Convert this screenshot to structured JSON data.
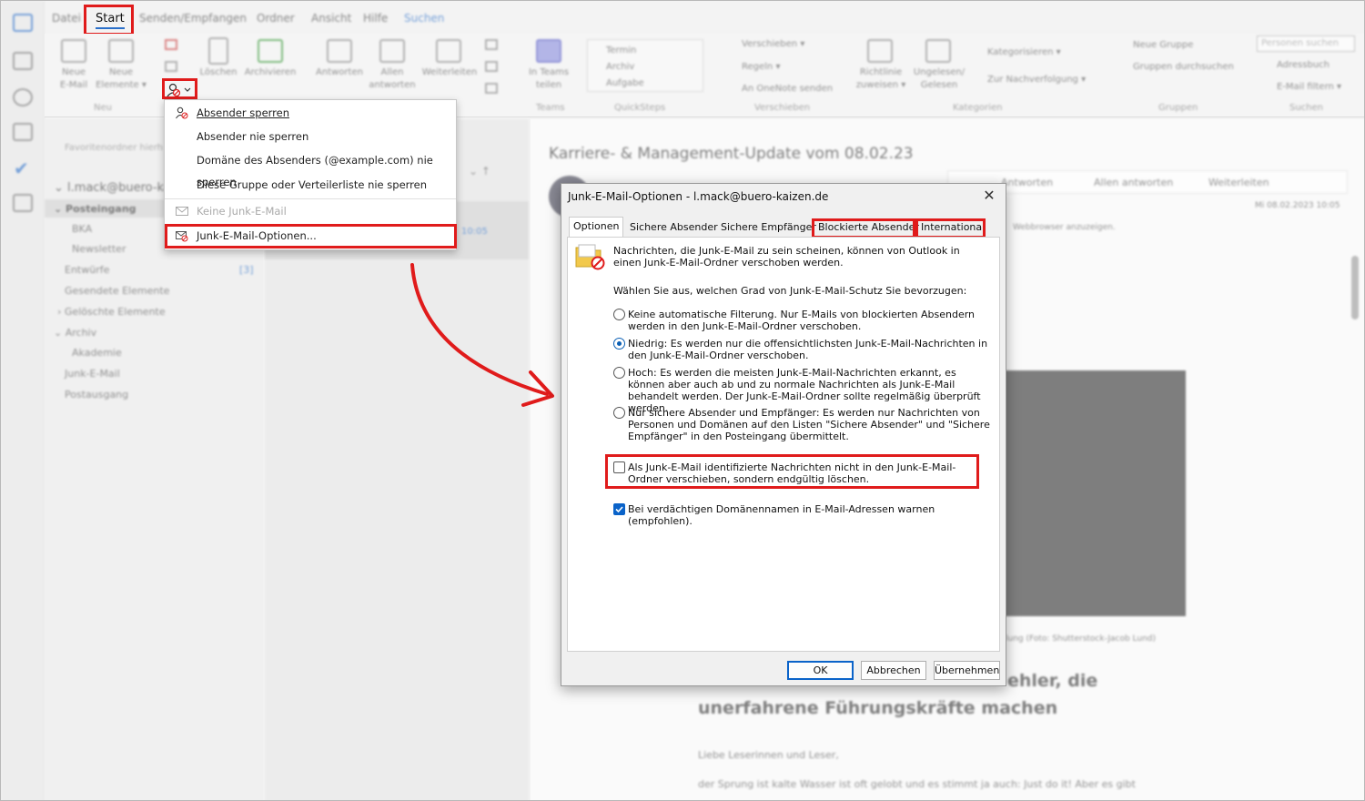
{
  "menubar": {
    "items": [
      "Datei",
      "Start",
      "Senden/Empfangen",
      "Ordner",
      "Ansicht",
      "Hilfe",
      "Suchen"
    ]
  },
  "ribbon": {
    "buttons": [
      {
        "label": "Neue\nE-Mail"
      },
      {
        "label": "Neue\nElemente ▾"
      },
      {
        "label": "Löschen"
      },
      {
        "label": "Archivieren"
      },
      {
        "label": "Antworten"
      },
      {
        "label": "Allen\nantworten"
      },
      {
        "label": "Weiterleiten"
      },
      {
        "label": "In Teams\nteilen"
      },
      {
        "label": "Richtlinie\nzuweisen ▾"
      },
      {
        "label": "Ungelesen/\nGelesen"
      }
    ],
    "quicksteps": [
      "Termin",
      "Archiv",
      "Aufgabe"
    ],
    "move": [
      "Verschieben ▾",
      "Regeln ▾",
      "An OneNote senden"
    ],
    "tags": [
      "Kategorisieren ▾",
      "Zur Nachverfolgung ▾"
    ],
    "groups_items": [
      "Neue Gruppe",
      "Gruppen durchsuchen"
    ],
    "search": {
      "placeholder": "Personen suchen",
      "items": [
        "Adressbuch",
        "E-Mail filtern ▾"
      ]
    },
    "group_labels": [
      "Neu",
      "Teams",
      "QuickSteps",
      "Verschieben",
      "Kategorien",
      "Gruppen",
      "Suchen"
    ]
  },
  "sidebar": {
    "favorites_hint": "Favoritenordner hierh",
    "account": "l.mack@buero-ka",
    "folders": [
      {
        "label": "Posteingang",
        "bold": true
      },
      {
        "label": "BKA"
      },
      {
        "label": "Newsletter"
      },
      {
        "label": "Entwürfe",
        "count": "[3]"
      },
      {
        "label": "Gesendete Elemente"
      },
      {
        "label": "Gelöschte Elemente"
      },
      {
        "label": "Archiv"
      },
      {
        "label": "Akademie"
      },
      {
        "label": "Junk-E-Mail"
      },
      {
        "label": "Postausgang"
      }
    ]
  },
  "reading": {
    "subject": "Karriere- & Management-Update vom 08.02.23",
    "actions": [
      "Antworten",
      "Allen antworten",
      "Weiterleiten"
    ],
    "date": "Mi 08.02.2023 10:05",
    "browser_hint": "Webbrowser anzuzeigen.",
    "caption": "lung (Foto: Shutterstock-Jacob Lund)",
    "headline_1": "ehler, die",
    "headline_2": "unerfahrene Führungskräfte machen",
    "body_1": "Liebe Leserinnen und Leser,",
    "body_2": "der Sprung ist kalte Wasser ist oft gelobt und es stimmt ja auch: Just do it! Aber es gibt"
  },
  "msglist": {
    "time": "10:05"
  },
  "context_menu": {
    "items": [
      {
        "label": "Absender sperren",
        "enabled": true,
        "icon": "block-sender-icon"
      },
      {
        "label": "Absender nie sperren",
        "enabled": true
      },
      {
        "label": "Domäne des Absenders (@example.com) nie sperren",
        "enabled": true
      },
      {
        "label": "Diese Gruppe oder Verteilerliste nie sperren",
        "enabled": true
      },
      {
        "label": "Keine Junk-E-Mail",
        "enabled": false,
        "icon": "mail-icon"
      },
      {
        "label": "Junk-E-Mail-Optionen...",
        "enabled": true,
        "icon": "junk-options-icon"
      }
    ]
  },
  "dialog": {
    "title": "Junk-E-Mail-Optionen - l.mack@buero-kaizen.de",
    "tabs": [
      "Optionen",
      "Sichere Absender",
      "Sichere Empfänger",
      "Blockierte Absender",
      "International"
    ],
    "active_tab": "Optionen",
    "intro": "Nachrichten, die Junk-E-Mail zu sein scheinen, können von Outlook in einen Junk-E-Mail-Ordner verschoben werden.",
    "level_prompt": "Wählen Sie aus, welchen Grad von Junk-E-Mail-Schutz Sie bevorzugen:",
    "levels": [
      {
        "text": "Keine automatische Filterung. Nur E-Mails von blockierten Absendern werden in den Junk-E-Mail-Ordner verschoben.",
        "selected": false
      },
      {
        "text": "Niedrig: Es werden nur die offensichtlichsten Junk-E-Mail-Nachrichten in den Junk-E-Mail-Ordner verschoben.",
        "selected": true
      },
      {
        "text": "Hoch: Es werden die meisten Junk-E-Mail-Nachrichten erkannt, es können aber auch ab und zu normale Nachrichten als Junk-E-Mail behandelt werden. Der Junk-E-Mail-Ordner sollte regelmäßig überprüft werden.",
        "selected": false
      },
      {
        "text": "Nur sichere Absender und Empfänger: Es werden nur Nachrichten von Personen und Domänen auf den Listen \"Sichere Absender\" und \"Sichere Empfänger\" in den Posteingang übermittelt.",
        "selected": false
      }
    ],
    "delete_option": {
      "text": "Als Junk-E-Mail identifizierte Nachrichten nicht in den Junk-E-Mail-Ordner verschieben, sondern endgültig löschen.",
      "checked": false
    },
    "warn_option": {
      "text": "Bei verdächtigen Domänennamen in E-Mail-Adressen warnen (empfohlen).",
      "checked": true
    },
    "buttons": {
      "ok": "OK",
      "cancel": "Abbrechen",
      "apply": "Übernehmen"
    }
  },
  "colors": {
    "highlight": "#e01b1b",
    "accent": "#0a63c9"
  }
}
